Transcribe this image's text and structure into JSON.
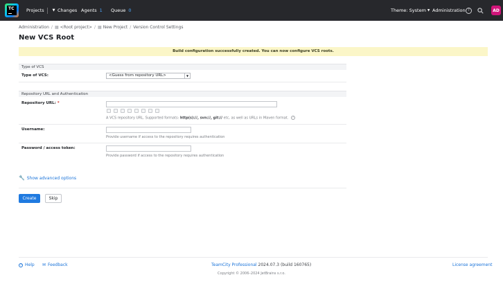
{
  "logo": {
    "text": "TC"
  },
  "nav": {
    "projects": "Projects",
    "changes": "Changes",
    "agents": "Agents",
    "agents_count": "1",
    "queue": "Queue",
    "queue_count": "0",
    "theme": "Theme: System",
    "administration": "Administration",
    "avatar": "AD"
  },
  "breadcrumb": [
    "Administration",
    "<Root project>",
    "New Project",
    "Version Control Settings"
  ],
  "page_title": "New VCS Root",
  "success_message": "Build configuration successfully created. You can now configure VCS roots.",
  "sections": {
    "type_of_vcs": "Type of VCS",
    "repo": "Repository URL and Authentication"
  },
  "form": {
    "vcs_type_label": "Type of VCS:",
    "vcs_type_value": "<Guess from repository URL>",
    "repo_url_label": "Repository URL:",
    "repo_url_required": "*",
    "repo_hint_pre": "A VCS repository URL. Supported formats:",
    "repo_hint_formats": "http(s)://, svn://, git://",
    "repo_hint_post": "etc, as well as URLs in Maven format.",
    "username_label": "Username:",
    "username_hint": "Provide username if access to the repository requires authentication",
    "password_label": "Password / access token:",
    "password_hint": "Provide password if access to the repository requires authentication"
  },
  "advanced_link": "Show advanced options",
  "buttons": {
    "create": "Create",
    "skip": "Skip"
  },
  "footer": {
    "help": "Help",
    "feedback": "Feedback",
    "product": "TeamCity Professional",
    "version": "2024.07.3 (build 160765)",
    "license": "License agreement",
    "copyright": "Copyright © 2006–2024 JetBrains s.r.o."
  },
  "colors": {
    "accent": "#1f7ae0",
    "topbar": "#27282c",
    "success_bg": "#fbf6c8",
    "avatar": "#d0157a"
  }
}
